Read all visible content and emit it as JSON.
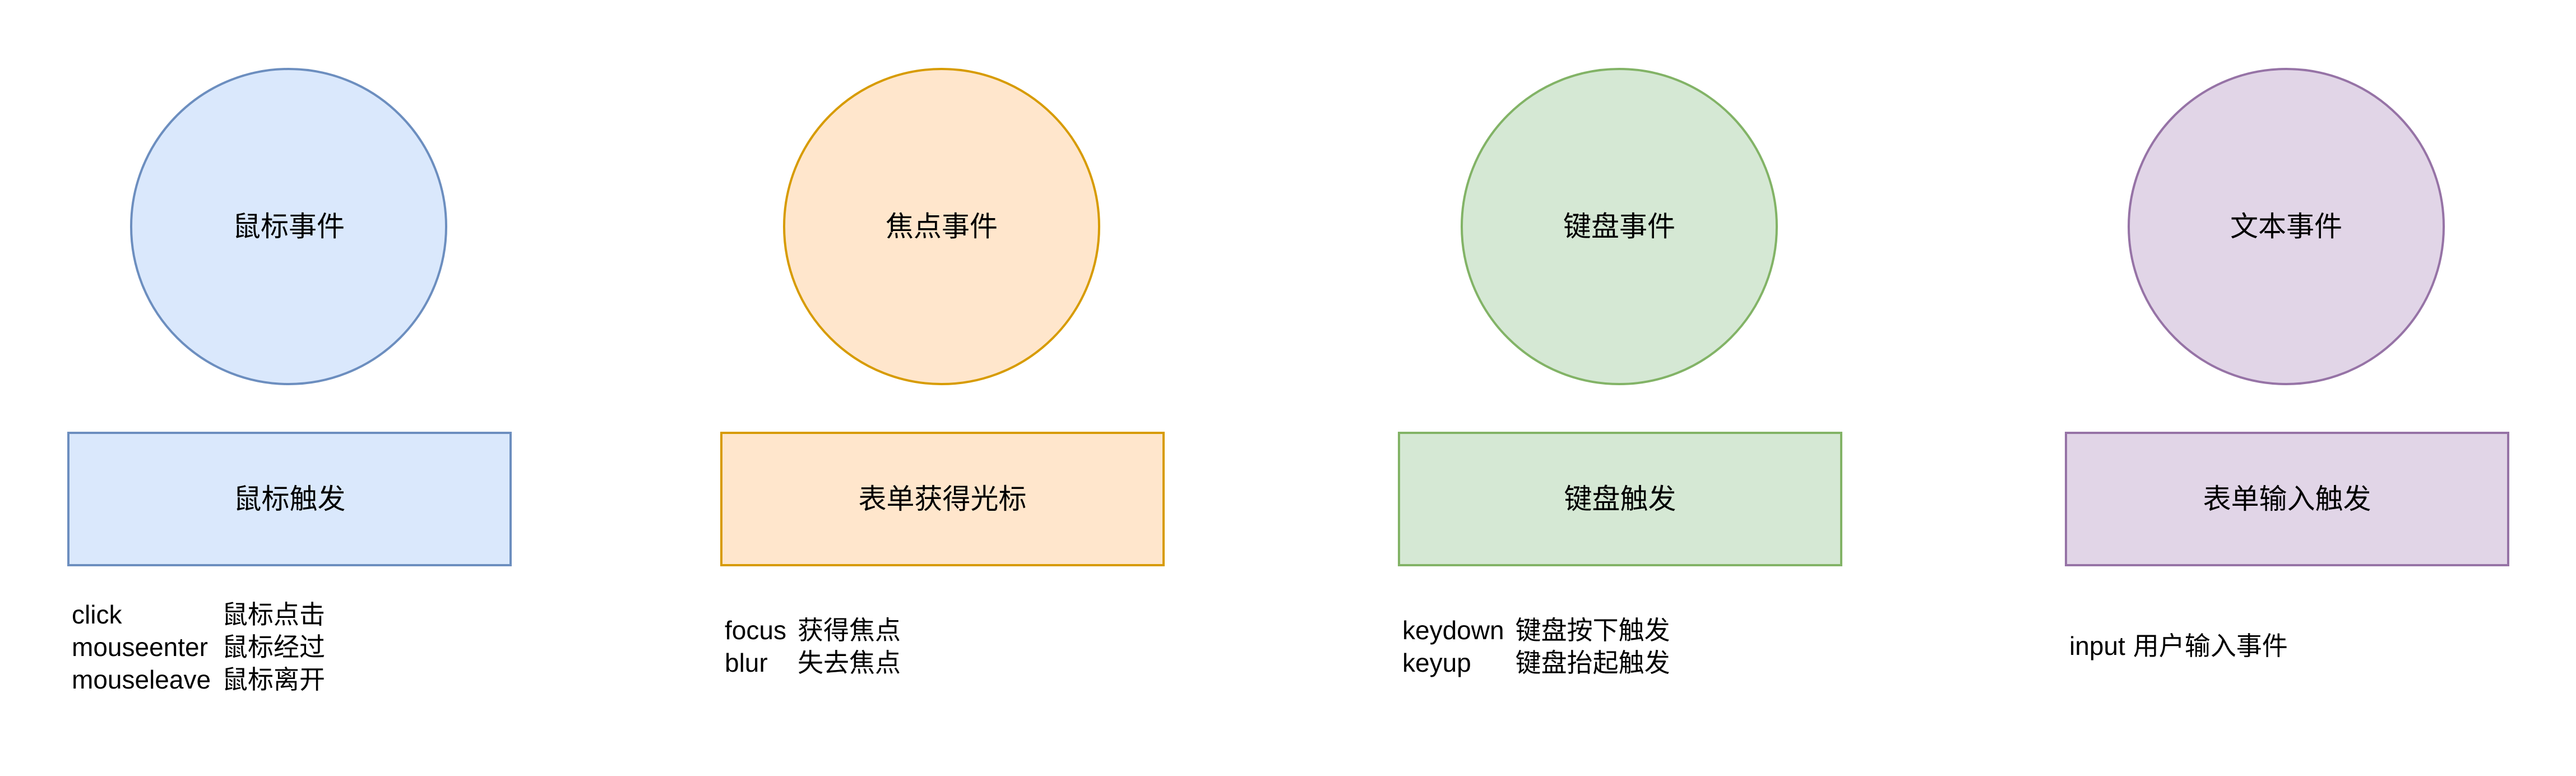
{
  "groups": [
    {
      "circle_label": "鼠标事件",
      "box_label": "鼠标触发",
      "colors": {
        "fill": "#dae8fc",
        "stroke": "#6c8ebf"
      },
      "events": [
        {
          "name": "click",
          "desc": "鼠标点击"
        },
        {
          "name": "mouseenter",
          "desc": "鼠标经过"
        },
        {
          "name": "mouseleave",
          "desc": "鼠标离开"
        }
      ]
    },
    {
      "circle_label": "焦点事件",
      "box_label": "表单获得光标",
      "colors": {
        "fill": "#ffe6cc",
        "stroke": "#d79b00"
      },
      "events": [
        {
          "name": "focus",
          "desc": "获得焦点"
        },
        {
          "name": "blur",
          "desc": "失去焦点"
        }
      ]
    },
    {
      "circle_label": "键盘事件",
      "box_label": "键盘触发",
      "colors": {
        "fill": "#d5e8d4",
        "stroke": "#82b366"
      },
      "events": [
        {
          "name": "keydown",
          "desc": "键盘按下触发"
        },
        {
          "name": "keyup",
          "desc": "键盘抬起触发"
        }
      ]
    },
    {
      "circle_label": "文本事件",
      "box_label": "表单输入触发",
      "colors": {
        "fill": "#e1d5e7",
        "stroke": "#9673a6"
      },
      "events": [
        {
          "name": "input",
          "desc": "用户输入事件"
        }
      ]
    }
  ]
}
